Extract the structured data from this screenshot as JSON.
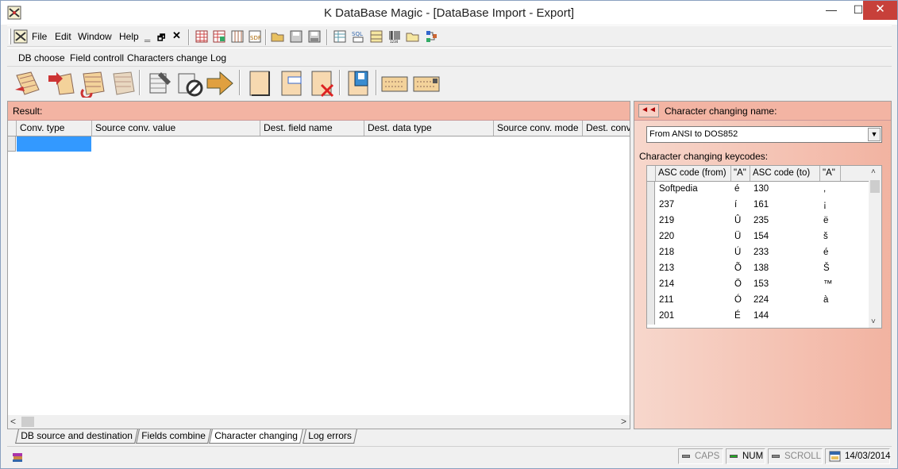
{
  "window": {
    "title": "K DataBase Magic - [DataBase Import - Export]",
    "controls": {
      "minimize": "—",
      "maximize": "☐",
      "close": "✕"
    }
  },
  "menubar": {
    "items": [
      "File",
      "Edit",
      "Window",
      "Help"
    ],
    "mdi_controls": [
      "‗",
      "🗗",
      "✕"
    ]
  },
  "submenu": {
    "items": [
      "DB choose",
      "Field controll",
      "Characters change",
      "Log"
    ]
  },
  "result_panel": {
    "header": "Result:",
    "columns": [
      "Conv. type",
      "Source conv. value",
      "Dest. field name",
      "Dest. data type",
      "Source conv. mode",
      "Dest. conv."
    ]
  },
  "char_panel": {
    "header": "Character changing name:",
    "collapse_icon": "◄◄",
    "selected_name": "From ANSI to DOS852",
    "keycodes_label": "Character changing keycodes:",
    "columns": [
      "ASC code (from)",
      "\"A\"",
      "ASC code (to)",
      "\"A\""
    ],
    "rows": [
      [
        "Softpedia",
        "é",
        "130",
        ","
      ],
      [
        "237",
        "í",
        "161",
        "¡"
      ],
      [
        "219",
        "Û",
        "235",
        "ë"
      ],
      [
        "220",
        "Ü",
        "154",
        "š"
      ],
      [
        "218",
        "Ú",
        "233",
        "é"
      ],
      [
        "213",
        "Õ",
        "138",
        "Š"
      ],
      [
        "214",
        "Ö",
        "153",
        "™"
      ],
      [
        "211",
        "Ó",
        "224",
        "à"
      ],
      [
        "201",
        "É",
        "144",
        ""
      ]
    ]
  },
  "tabs": [
    "DB source and destination",
    "Fields combine",
    "Character changing",
    "Log errors"
  ],
  "statusbar": {
    "caps": "CAPS",
    "num": "NUM",
    "scroll": "SCROLL",
    "date": "14/03/2014"
  },
  "colors": {
    "header_salmon": "#f3b4a3",
    "selection": "#3399ff",
    "close_red": "#c7403a"
  }
}
